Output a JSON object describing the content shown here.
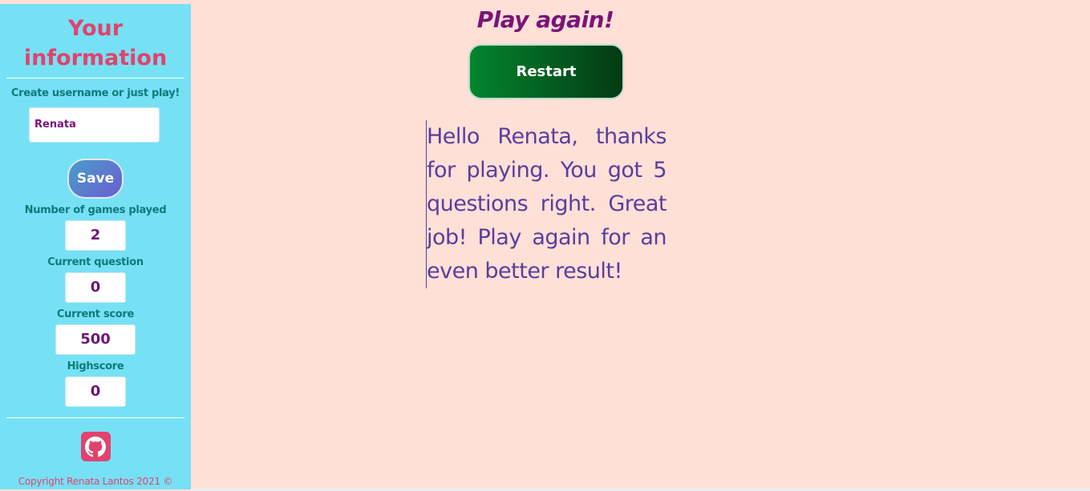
{
  "sidebar": {
    "title": "Your information",
    "prompt": "Create username or just play!",
    "username_value": "Renata",
    "save_label": "Save",
    "stats": [
      {
        "label": "Number of games played",
        "value": "2"
      },
      {
        "label": "Current question",
        "value": "0"
      },
      {
        "label": "Current score",
        "value": "500"
      },
      {
        "label": "Highscore",
        "value": "0"
      }
    ],
    "github_icon": "github-icon",
    "copyright": "Copyright Renata Lantos 2021 ©"
  },
  "main": {
    "heading": "Play again!",
    "restart_label": "Restart",
    "message": "Hello Renata, thanks for playing. You got 5 questions right. Great job! Play again for an even better result!"
  },
  "colors": {
    "sidebar_bg": "#76e1f5",
    "page_bg": "#ffe0d6",
    "accent_pink": "#e0436e",
    "heading_purple": "#7a1479",
    "restart_green": "#03852e"
  }
}
